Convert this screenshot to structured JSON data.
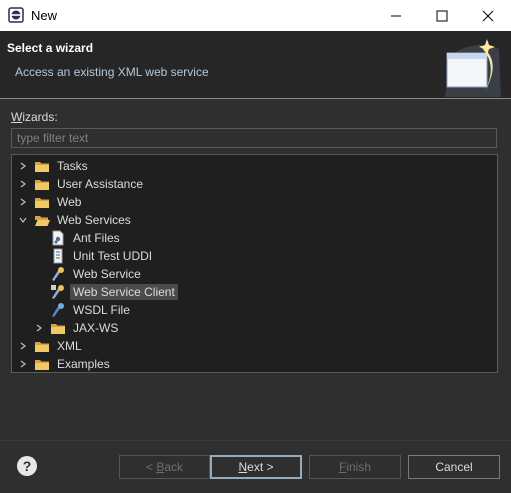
{
  "window": {
    "title": "New"
  },
  "header": {
    "title": "Select a wizard",
    "description": "Access an existing XML web service"
  },
  "wizards_label": {
    "prefix": "W",
    "rest": "izards:"
  },
  "filter": {
    "placeholder": "type filter text"
  },
  "tree": [
    {
      "label": "Tasks",
      "icon": "folder-icon",
      "expanded": false
    },
    {
      "label": "User Assistance",
      "icon": "folder-icon",
      "expanded": false
    },
    {
      "label": "Web",
      "icon": "folder-icon",
      "expanded": false
    },
    {
      "label": "Web Services",
      "icon": "folder-icon",
      "expanded": true
    },
    {
      "label": "Ant Files",
      "icon": "ant-file-icon"
    },
    {
      "label": "Unit Test UDDI",
      "icon": "uddi-icon"
    },
    {
      "label": "Web Service",
      "icon": "web-service-icon"
    },
    {
      "label": "Web Service Client",
      "icon": "web-service-client-icon",
      "selected": true
    },
    {
      "label": "WSDL File",
      "icon": "wsdl-file-icon"
    },
    {
      "label": "JAX-WS",
      "icon": "folder-icon",
      "expanded": false
    },
    {
      "label": "XML",
      "icon": "folder-icon",
      "expanded": false
    },
    {
      "label": "Examples",
      "icon": "folder-icon",
      "expanded": false
    }
  ],
  "buttons": {
    "back": {
      "prefix": "< ",
      "mnemonic": "B",
      "rest": "ack",
      "enabled": false
    },
    "next": {
      "prefix": "",
      "mnemonic": "N",
      "rest": "ext >",
      "enabled": true
    },
    "finish": {
      "prefix": "",
      "mnemonic": "F",
      "rest": "inish",
      "enabled": false
    },
    "cancel": {
      "label": "Cancel",
      "enabled": true
    }
  },
  "help": {
    "label": "?"
  },
  "colors": {
    "background": "#2f2f2f",
    "tree_background": "#1f1f1f",
    "selection": "#4b4b4b",
    "folder": "#e8b84a"
  }
}
